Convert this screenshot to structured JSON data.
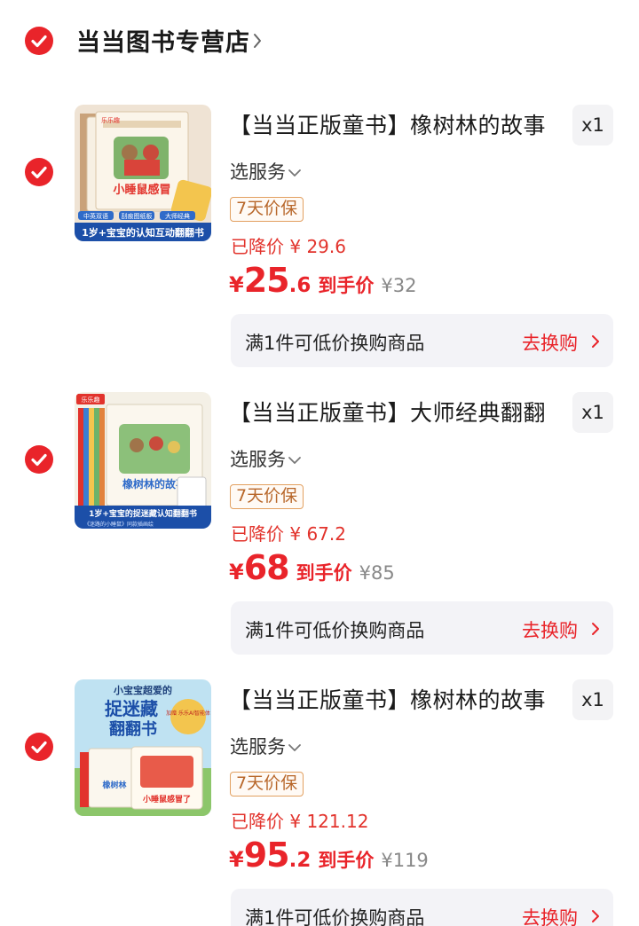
{
  "store": {
    "name": "当当图书专营店"
  },
  "items": [
    {
      "title": "【当当正版童书】橡树林的故事",
      "qty": "x1",
      "service": "选服务",
      "tag": "7天价保",
      "reduced": "已降价 ¥ 29.6",
      "currency": "¥",
      "price_int": "25",
      "price_dec": ".6",
      "final_label": "到手价",
      "orig_price": "¥32",
      "exchange_text": "满1件可低价换购商品",
      "exchange_link": "去换购",
      "cover": {
        "brand": "乐乐趣",
        "book_title": "小睡鼠感冒",
        "banner": "1岁+宝宝的认知互动翻翻书",
        "chips": [
          "中英双语",
          "刮痕图纸板",
          "大师经典"
        ]
      }
    },
    {
      "title": "【当当正版童书】大师经典翻翻",
      "qty": "x1",
      "service": "选服务",
      "tag": "7天价保",
      "reduced": "已降价 ¥ 67.2",
      "currency": "¥",
      "price_int": "68",
      "price_dec": "",
      "final_label": "到手价",
      "orig_price": "¥85",
      "exchange_text": "满1件可低价换购商品",
      "exchange_link": "去换购",
      "cover": {
        "brand": "乐乐趣",
        "book_title": "橡树林的故事",
        "banner": "1岁+宝宝的捉迷藏认知翻翻书",
        "sub_banner": "《迷路的小睡鼠》同款插画绘"
      }
    },
    {
      "title": "【当当正版童书】橡树林的故事",
      "qty": "x1",
      "service": "选服务",
      "tag": "7天价保",
      "reduced": "已降价 ¥ 121.12",
      "currency": "¥",
      "price_int": "95",
      "price_dec": ".2",
      "final_label": "到手价",
      "orig_price": "¥119",
      "exchange_text": "满1件可低价换购商品",
      "exchange_link": "去换购",
      "cover": {
        "top_text": "小宝宝超爱的",
        "big_text_1": "捉迷藏",
        "big_text_2": "翻翻书",
        "badge": "加赠 乐乐AI智能体",
        "book_a": "橡树林",
        "book_b": "小睡鼠感冒了"
      }
    }
  ],
  "colors": {
    "accent": "#e9242a",
    "tag_border": "#e2a060",
    "panel": "#f3f3f7"
  }
}
